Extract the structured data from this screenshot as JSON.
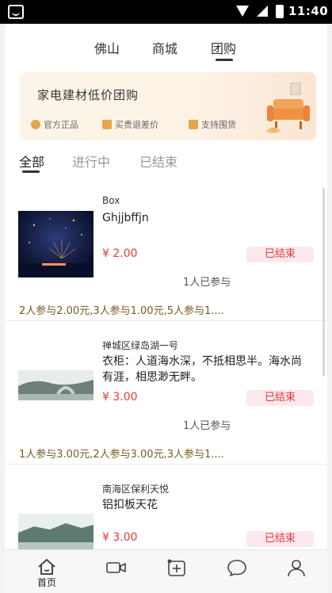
{
  "status_bar": {
    "time": "11:40"
  },
  "top_tabs": [
    "佛山",
    "商城",
    "团购"
  ],
  "banner": {
    "title": "家电建材低价团购",
    "features": [
      "官方正品",
      "买贵退差价",
      "支持围货"
    ]
  },
  "filters": [
    "全部",
    "进行中",
    "已结束"
  ],
  "items": [
    {
      "address": "Box",
      "title": "Ghjjbffjn",
      "price": "¥ 2.00",
      "status": "已结束",
      "joined": "1人已参与",
      "rules": "2人参与2.00元,3人参与1.00元,5人参与1...."
    },
    {
      "address": "禅城区绿岛湖一号",
      "title": "衣柜：人道海水深，不抵相思半。海水尚有涯，相思渺无畔。",
      "price": "¥ 3.00",
      "status": "已结束",
      "joined": "1人已参与",
      "rules": "1人参与3.00元,2人参与3.00元,3人参与1...."
    },
    {
      "address": "南海区保利天悦",
      "title": "铝扣板天花",
      "price": "¥ 3.00",
      "status": "已结束"
    }
  ],
  "bottom_nav": [
    {
      "label": "首页",
      "icon": "home-icon"
    },
    {
      "label": "",
      "icon": "video-icon"
    },
    {
      "label": "",
      "icon": "publish-icon"
    },
    {
      "label": "",
      "icon": "message-icon"
    },
    {
      "label": "",
      "icon": "profile-icon"
    }
  ],
  "colors": {
    "accent_red": "#e4383e",
    "status_badge_bg": "#fde8ec",
    "rule_text": "#7a5a1e",
    "banner_gold": "#e8a44a"
  }
}
